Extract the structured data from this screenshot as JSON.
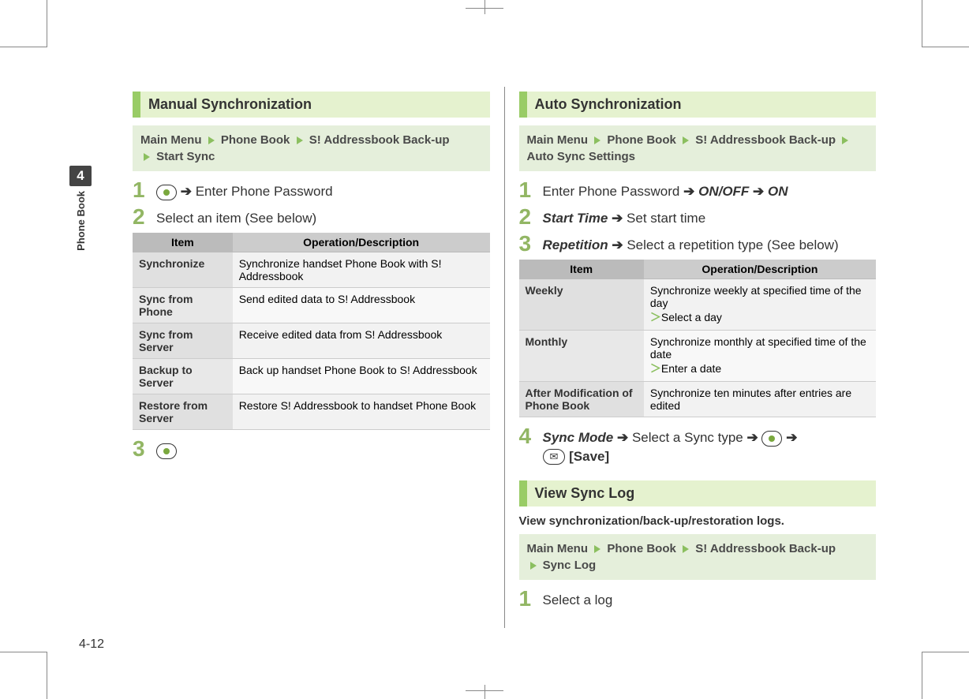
{
  "side_tab": {
    "chapter_number": "4",
    "chapter_title": "Phone Book"
  },
  "page_number": "4-12",
  "left": {
    "heading": "Manual Synchronization",
    "nav": {
      "seg1": "Main Menu",
      "seg2": "Phone Book",
      "seg3": "S! Addressbook Back-up",
      "seg4": "Start Sync"
    },
    "steps": {
      "s1": {
        "n": "1",
        "text": "Enter Phone Password"
      },
      "s2": {
        "n": "2",
        "text": "Select an item (See below)"
      },
      "s3": {
        "n": "3"
      }
    },
    "table": {
      "h1": "Item",
      "h2": "Operation/Description",
      "rows": [
        {
          "item": "Synchronize",
          "desc": "Synchronize handset Phone Book with S! Addressbook"
        },
        {
          "item": "Sync from Phone",
          "desc": "Send edited data to S! Addressbook"
        },
        {
          "item": "Sync from Server",
          "desc": "Receive edited data from S! Addressbook"
        },
        {
          "item": "Backup to Server",
          "desc": "Back up handset Phone Book to S! Addressbook"
        },
        {
          "item": "Restore from Server",
          "desc": "Restore S! Addressbook to handset Phone Book"
        }
      ]
    }
  },
  "right": {
    "auto": {
      "heading": "Auto Synchronization",
      "nav": {
        "seg1": "Main Menu",
        "seg2": "Phone Book",
        "seg3": "S! Addressbook Back-up",
        "seg4": "Auto Sync Settings"
      },
      "steps": {
        "s1": {
          "n": "1",
          "text": "Enter Phone Password",
          "em1": "ON/OFF",
          "em2": "ON"
        },
        "s2": {
          "n": "2",
          "em": "Start Time",
          "text": "Set start time"
        },
        "s3": {
          "n": "3",
          "em": "Repetition",
          "text": "Select a repetition type (See below)"
        },
        "s4": {
          "n": "4",
          "em": "Sync Mode",
          "text": "Select a Sync type",
          "save": "[Save]"
        }
      },
      "table": {
        "h1": "Item",
        "h2": "Operation/Description",
        "rows": [
          {
            "item": "Weekly",
            "desc": "Synchronize weekly at specified time of the day",
            "sub": "Select a day"
          },
          {
            "item": "Monthly",
            "desc": "Synchronize monthly at specified time of the date",
            "sub": "Enter a date"
          },
          {
            "item": "After Modification of Phone Book",
            "desc": "Synchronize ten minutes after entries are edited"
          }
        ]
      }
    },
    "log": {
      "heading": "View Sync Log",
      "desc": "View synchronization/back-up/restoration logs.",
      "nav": {
        "seg1": "Main Menu",
        "seg2": "Phone Book",
        "seg3": "S! Addressbook Back-up",
        "seg4": "Sync Log"
      },
      "step": {
        "n": "1",
        "text": "Select a log"
      }
    }
  }
}
